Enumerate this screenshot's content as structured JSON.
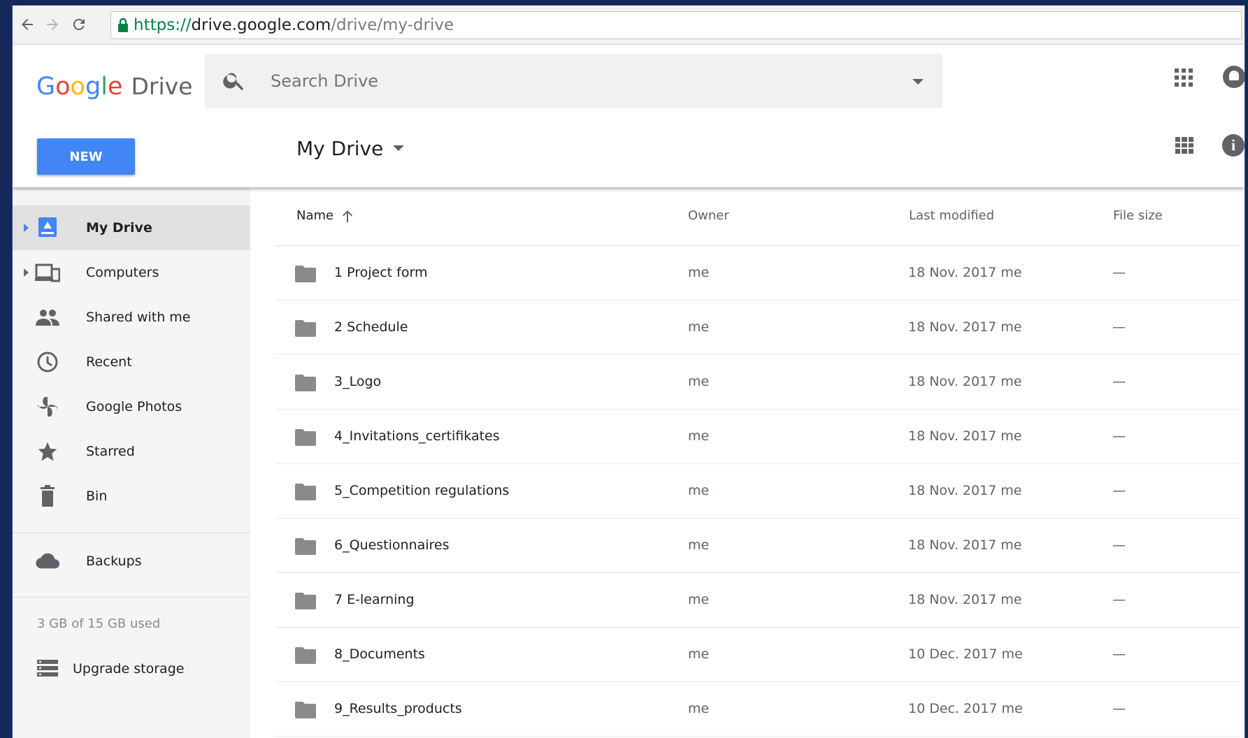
{
  "browser": {
    "url_scheme": "https://",
    "url_host": "drive.google.com",
    "url_path": "/drive/my-drive"
  },
  "header": {
    "logo_word": "Drive",
    "search_placeholder": "Search Drive",
    "new_label": "NEW",
    "location_title": "My Drive"
  },
  "sidebar": {
    "items": [
      {
        "label": "My Drive",
        "icon": "my-drive-icon"
      },
      {
        "label": "Computers",
        "icon": "computers-icon"
      },
      {
        "label": "Shared with me",
        "icon": "shared-icon"
      },
      {
        "label": "Recent",
        "icon": "clock-icon"
      },
      {
        "label": "Google Photos",
        "icon": "pinwheel-icon"
      },
      {
        "label": "Starred",
        "icon": "star-icon"
      },
      {
        "label": "Bin",
        "icon": "trash-icon"
      }
    ],
    "backups_label": "Backups",
    "storage_text": "3 GB of 15 GB used",
    "upgrade_label": "Upgrade storage"
  },
  "list": {
    "columns": {
      "name": "Name",
      "owner": "Owner",
      "modified": "Last modified",
      "size": "File size"
    },
    "rows": [
      {
        "name": "1 Project form",
        "owner": "me",
        "modified": "18 Nov. 2017 me",
        "size": "—"
      },
      {
        "name": "2 Schedule",
        "owner": "me",
        "modified": "18 Nov. 2017 me",
        "size": "—"
      },
      {
        "name": "3_Logo",
        "owner": "me",
        "modified": "18 Nov. 2017 me",
        "size": "—"
      },
      {
        "name": "4_Invitations_certifikates",
        "owner": "me",
        "modified": "18 Nov. 2017 me",
        "size": "—"
      },
      {
        "name": "5_Competition regulations",
        "owner": "me",
        "modified": "18 Nov. 2017 me",
        "size": "—"
      },
      {
        "name": "6_Questionnaires",
        "owner": "me",
        "modified": "18 Nov. 2017 me",
        "size": "—"
      },
      {
        "name": "7 E-learning",
        "owner": "me",
        "modified": "18 Nov. 2017 me",
        "size": "—"
      },
      {
        "name": "8_Documents",
        "owner": "me",
        "modified": "10 Dec. 2017 me",
        "size": "—"
      },
      {
        "name": "9_Results_products",
        "owner": "me",
        "modified": "10 Dec. 2017 me",
        "size": "—"
      }
    ]
  },
  "colors": {
    "accent": "#4285f4",
    "sidebar_bg": "#f5f5f5",
    "selected_bg": "#e1e1e1",
    "folder": "#8a8a8a"
  }
}
